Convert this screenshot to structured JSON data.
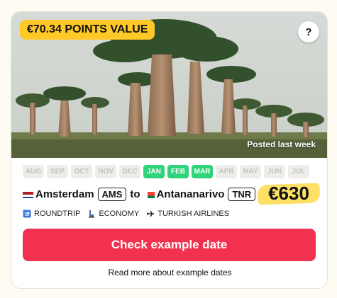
{
  "deal": {
    "points_badge": "€70.34 POINTS VALUE",
    "help_label": "?",
    "posted": "Posted last week",
    "months": [
      {
        "label": "AUG",
        "active": false
      },
      {
        "label": "SEP",
        "active": false
      },
      {
        "label": "OCT",
        "active": false
      },
      {
        "label": "NOV",
        "active": false
      },
      {
        "label": "DEC",
        "active": false
      },
      {
        "label": "JAN",
        "active": true
      },
      {
        "label": "FEB",
        "active": true
      },
      {
        "label": "MAR",
        "active": true
      },
      {
        "label": "APR",
        "active": false
      },
      {
        "label": "MAY",
        "active": false
      },
      {
        "label": "JUN",
        "active": false
      },
      {
        "label": "JUL",
        "active": false
      }
    ],
    "origin": {
      "city": "Amsterdam",
      "code": "AMS",
      "flag_icon": "netherlands-flag-icon"
    },
    "to_label": "to",
    "destination": {
      "city": "Antananarivo",
      "code": "TNR",
      "flag_icon": "madagascar-flag-icon"
    },
    "price": "€630",
    "trip_type": "ROUNDTRIP",
    "cabin": "ECONOMY",
    "airline": "TURKISH AIRLINES",
    "cta_label": "Check example date",
    "more_link": "Read more about example dates"
  },
  "colors": {
    "badge": "#ffc928",
    "active_month": "#2fd37a",
    "cta": "#f2314f",
    "price_highlight": "#ffe066"
  }
}
